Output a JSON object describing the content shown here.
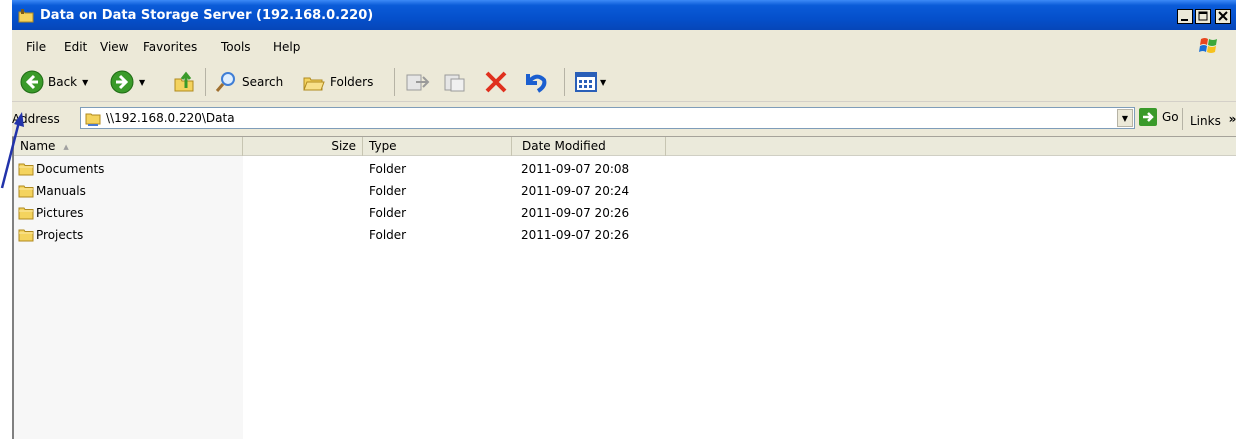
{
  "window": {
    "title": "Data on Data Storage Server (192.168.0.220)"
  },
  "menu": {
    "items": [
      {
        "label": "File"
      },
      {
        "label": "Edit"
      },
      {
        "label": "View"
      },
      {
        "label": "Favorites"
      },
      {
        "label": "Tools"
      },
      {
        "label": "Help"
      }
    ]
  },
  "toolbar": {
    "back_label": "Back",
    "search_label": "Search",
    "folders_label": "Folders"
  },
  "address": {
    "label": "Address",
    "value": "\\\\192.168.0.220\\Data",
    "go_label": "Go",
    "links_label": "Links",
    "links_chevron": "»"
  },
  "columns": {
    "name": "Name",
    "size": "Size",
    "type": "Type",
    "date": "Date Modified"
  },
  "files": [
    {
      "name": "Documents",
      "size": "",
      "type": "Folder",
      "date": "2011-09-07 20:08"
    },
    {
      "name": "Manuals",
      "size": "",
      "type": "Folder",
      "date": "2011-09-07 20:24"
    },
    {
      "name": "Pictures",
      "size": "",
      "type": "Folder",
      "date": "2011-09-07 20:26"
    },
    {
      "name": "Projects",
      "size": "",
      "type": "Folder",
      "date": "2011-09-07 20:26"
    }
  ],
  "colors": {
    "titlebar": "#0550cc",
    "accent_green": "#3a9a2a",
    "annotation": "#2233aa"
  }
}
